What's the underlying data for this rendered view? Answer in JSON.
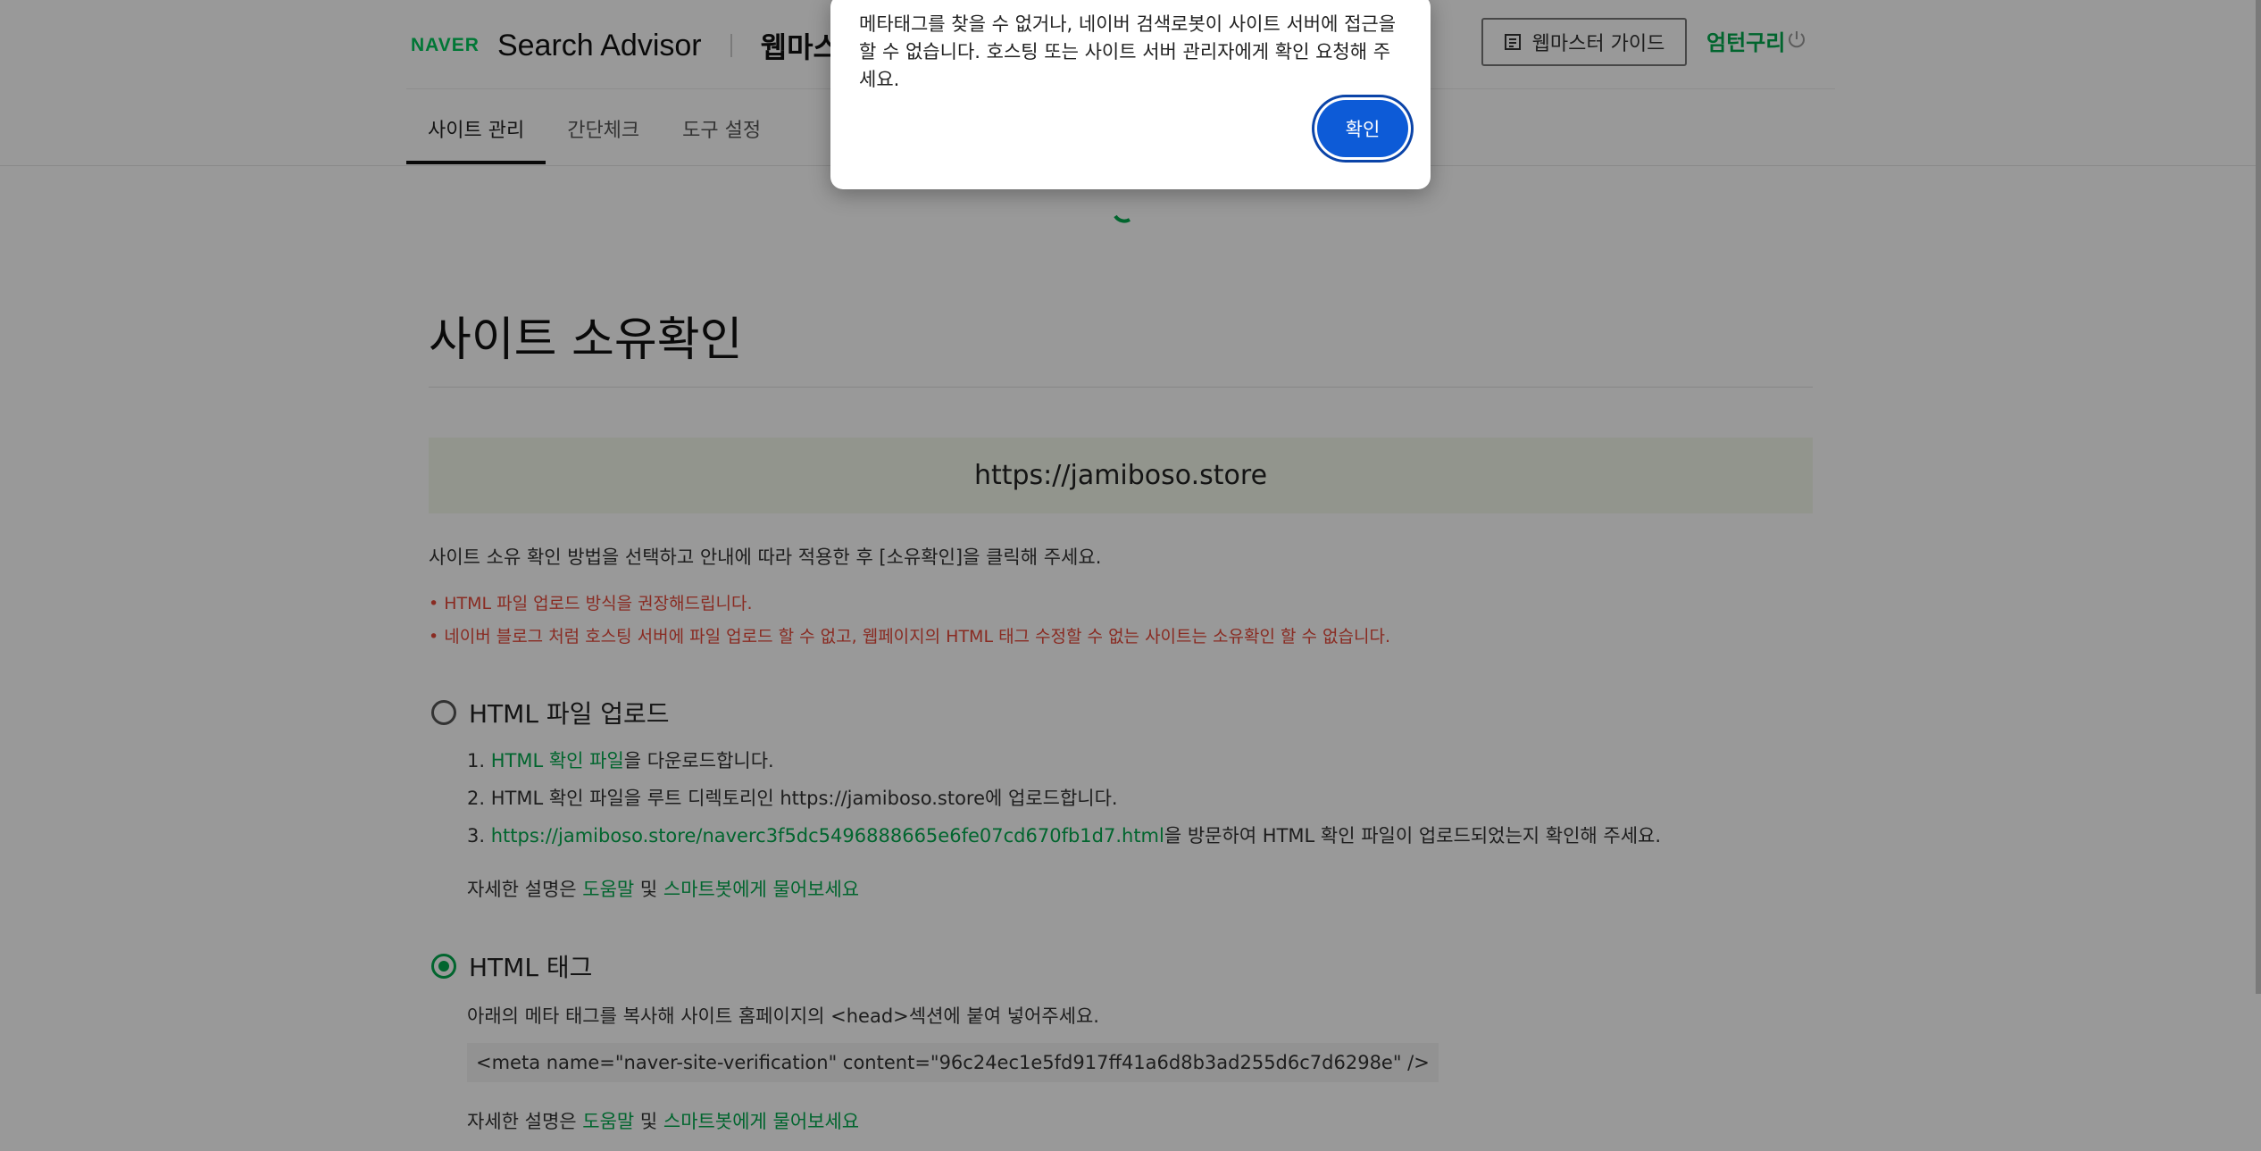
{
  "header": {
    "naver_logo": "NAVER",
    "product_name": "Search Advisor",
    "section_title": "웹마스터 도구",
    "guide_button": "웹마스터 가이드",
    "user_name": "엄턴구리",
    "accent_color": "#03c75a"
  },
  "tabs": [
    {
      "label": "사이트 관리",
      "active": true
    },
    {
      "label": "간단체크",
      "active": false
    },
    {
      "label": "도구 설정",
      "active": false
    }
  ],
  "main": {
    "title": "사이트 소유확인",
    "site_url": "https://jamiboso.store",
    "intro": "사이트 소유 확인 방법을 선택하고 안내에 따라 적용한 후 [소유확인]을 클릭해 주세요.",
    "note1": "• HTML 파일 업로드 방식을 권장해드립니다.",
    "note2": "• 네이버 블로그 처럼 호스팅 서버에 파일 업로드 할 수 없고, 웹페이지의 HTML 태그 수정할 수 없는 사이트는 소유확인 할 수 없습니다.",
    "option_file": {
      "label": "HTML 파일 업로드",
      "selected": false,
      "step1_link": "HTML 확인 파일",
      "step1_rest": "을 다운로드합니다.",
      "step1_num": "1. ",
      "step2": "2. HTML 확인 파일을 루트 디렉토리인 https://jamiboso.store에 업로드합니다.",
      "step3_num": "3. ",
      "step3_link": "https://jamiboso.store/naverc3f5dc5496888665e6fe07cd670fb1d7.html",
      "step3_rest": "을 방문하여 HTML 확인 파일이 업로드되었는지 확인해 주세요."
    },
    "help": {
      "prefix": "자세한 설명은 ",
      "help_link": "도움말",
      "middle": " 및 ",
      "bot_link": "스마트봇에게 물어보세요"
    },
    "option_tag": {
      "label": "HTML 태그",
      "selected": true,
      "description": "아래의 메타 태그를 복사해 사이트 홈페이지의 <head>섹션에 붙여 넣어주세요.",
      "meta_tag": "<meta name=\"naver-site-verification\" content=\"96c24ec1e5fd917ff41a6d8b3ad255d6c7d6298e\" />"
    }
  },
  "modal": {
    "message": "메타태그를 찾을 수 없거나, 네이버 검색로봇이 사이트 서버에 접근을 할 수 없습니다. 호스팅 또는 사이트 서버 관리자에게 확인 요청해 주세요.",
    "ok_button": "확인",
    "button_color": "#0d5bd7"
  }
}
